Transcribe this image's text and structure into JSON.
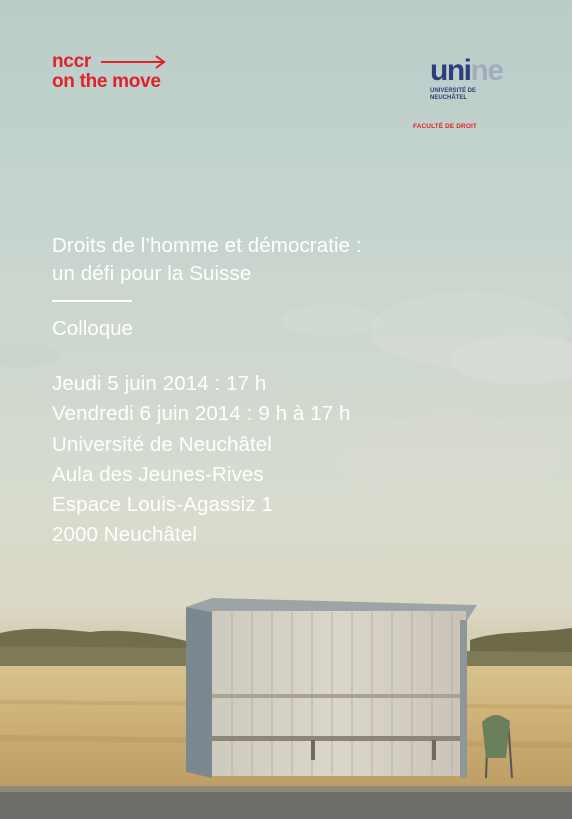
{
  "logos": {
    "nccr_line1": "nccr",
    "nccr_line2": "on the move",
    "unine_part1": "uni",
    "unine_part2": "ne",
    "unine_sub1": "UNIVERSITÉ DE",
    "unine_sub2": "NEUCHÂTEL",
    "faculty": "FACULTÉ DE DROIT"
  },
  "title": {
    "line1": "Droits de l’homme et démocratie :",
    "line2": "un défi pour la Suisse"
  },
  "subtitle": "Colloque",
  "info": [
    "Jeudi 5 juin 2014 : 17 h",
    "Vendredi 6 juin 2014 : 9 h à 17 h",
    "Université de Neuchâtel",
    "Aula des Jeunes-Rives",
    "Espace Louis-Agassiz 1",
    "2000 Neuchâtel"
  ],
  "colors": {
    "brand_red": "#e1212b",
    "unine_blue": "#2a3f7c",
    "text": "#ffffff"
  }
}
